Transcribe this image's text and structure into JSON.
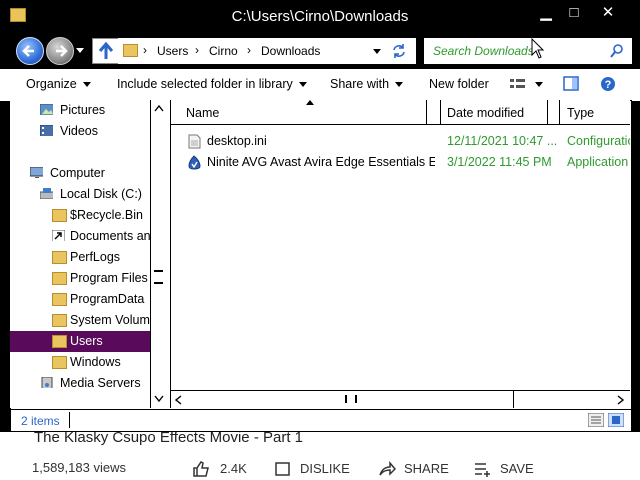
{
  "window": {
    "title": "C:\\Users\\Cirno\\Downloads",
    "minimize_glyph": "▁",
    "maximize_glyph": "□",
    "close_glyph": "✕"
  },
  "address": {
    "crumbs": [
      "Users",
      "Cirno",
      "Downloads"
    ],
    "separator": "›",
    "search_placeholder": "Search Downloads"
  },
  "toolbar": {
    "organize": "Organize",
    "include_library": "Include selected folder in library",
    "share_with": "Share with",
    "new_folder": "New folder"
  },
  "nav": {
    "items": [
      {
        "label": "Pictures",
        "icon": "pictures-icon"
      },
      {
        "label": "Videos",
        "icon": "videos-icon"
      },
      {
        "label": "Computer",
        "icon": "computer-icon"
      },
      {
        "label": "Local Disk (C:)",
        "icon": "drive-icon"
      },
      {
        "label": "$Recycle.Bin",
        "icon": "folder-icon"
      },
      {
        "label": "Documents and",
        "icon": "shortcut-folder-icon"
      },
      {
        "label": "PerfLogs",
        "icon": "folder-icon"
      },
      {
        "label": "Program Files",
        "icon": "folder-icon"
      },
      {
        "label": "ProgramData",
        "icon": "folder-icon"
      },
      {
        "label": "System Volume",
        "icon": "folder-icon"
      },
      {
        "label": "Users",
        "icon": "folder-icon",
        "selected": true
      },
      {
        "label": "Windows",
        "icon": "folder-icon"
      },
      {
        "label": "Media Servers",
        "icon": "media-servers-icon"
      }
    ],
    "selected_color": "#5a0a5a"
  },
  "columns": {
    "name": "Name",
    "date_modified": "Date modified",
    "type": "Type"
  },
  "files": [
    {
      "name": "desktop.ini",
      "date": "12/11/2021 10:47 ...",
      "type": "Configuratio",
      "icon": "ini-file-icon"
    },
    {
      "name": "Ninite AVG Avast Avira Edge Essentials Ev...",
      "date": "3/1/2022 11:45 PM",
      "type": "Application",
      "icon": "installer-icon"
    }
  ],
  "status": {
    "item_count": "2 items"
  },
  "background_page": {
    "video_title": "The Klasky Csupo Effects Movie - Part 1",
    "views": "1,589,183 views",
    "likes": "2.4K",
    "dislike": "DISLIKE",
    "share": "SHARE",
    "save": "SAVE"
  },
  "colors": {
    "accent_green": "#2f9a2f",
    "selection": "#5a0a5a",
    "link_blue": "#2a67c8"
  }
}
